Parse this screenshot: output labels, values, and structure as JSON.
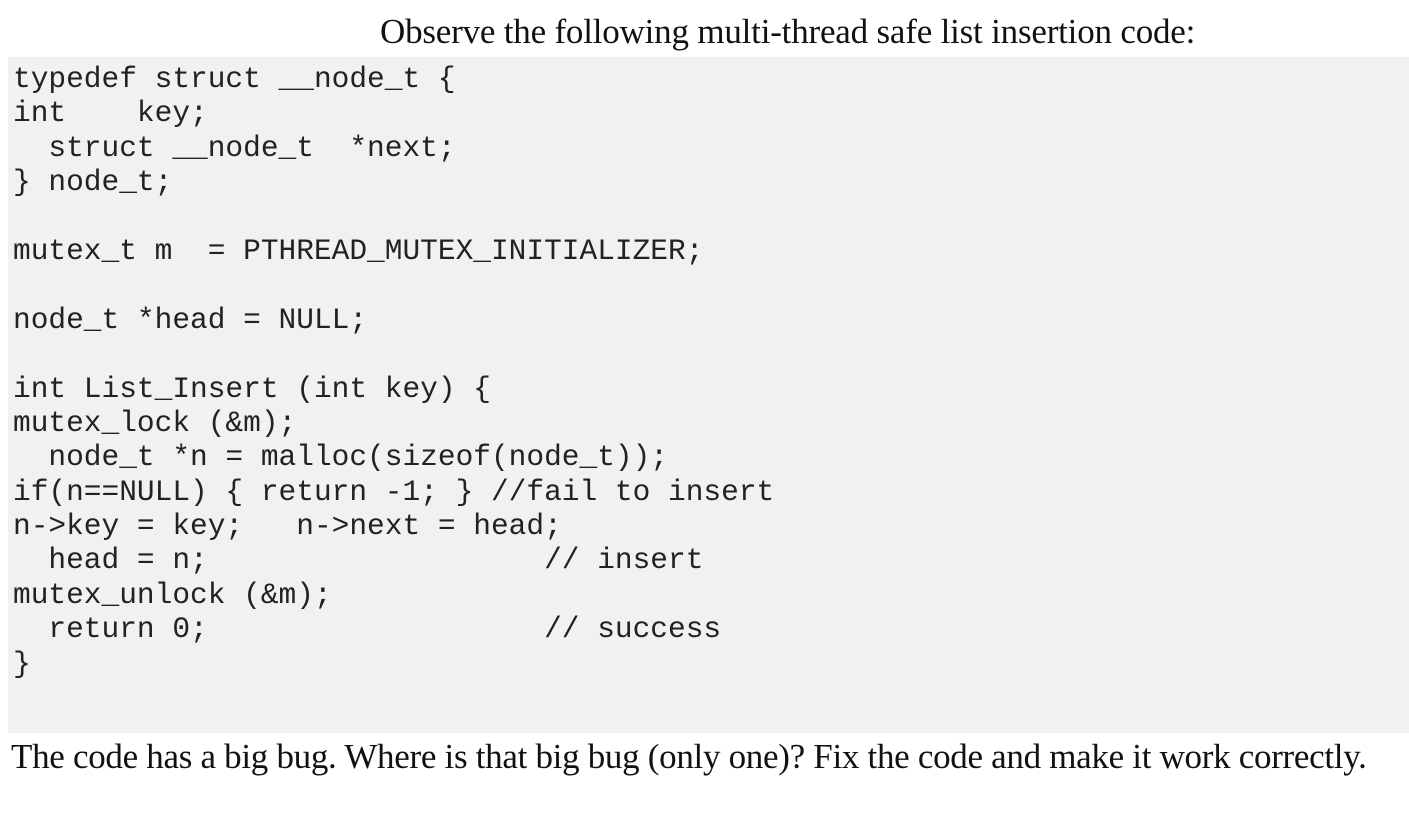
{
  "document": {
    "title": "Observe the following multi-thread safe list insertion code:",
    "code_lines": [
      "typedef struct __node_t {",
      "int    key;",
      "  struct __node_t  *next;",
      "} node_t;",
      "",
      "mutex_t m  = PTHREAD_MUTEX_INITIALIZER;",
      "",
      "node_t *head = NULL;",
      "",
      "int List_Insert (int key) {",
      "mutex_lock (&m);",
      "  node_t *n = malloc(sizeof(node_t));",
      "if(n==NULL) { return -1; } //fail to insert",
      "n->key = key;   n->next = head;",
      "  head = n;                   // insert",
      "mutex_unlock (&m);",
      "  return 0;                   // success",
      "}"
    ],
    "question": "The code has a big bug. Where is that big bug (only one)? Fix the code and make it work correctly."
  },
  "colors": {
    "code_background": "#f1f1f1",
    "text": "#111111",
    "code_text": "#222222"
  }
}
